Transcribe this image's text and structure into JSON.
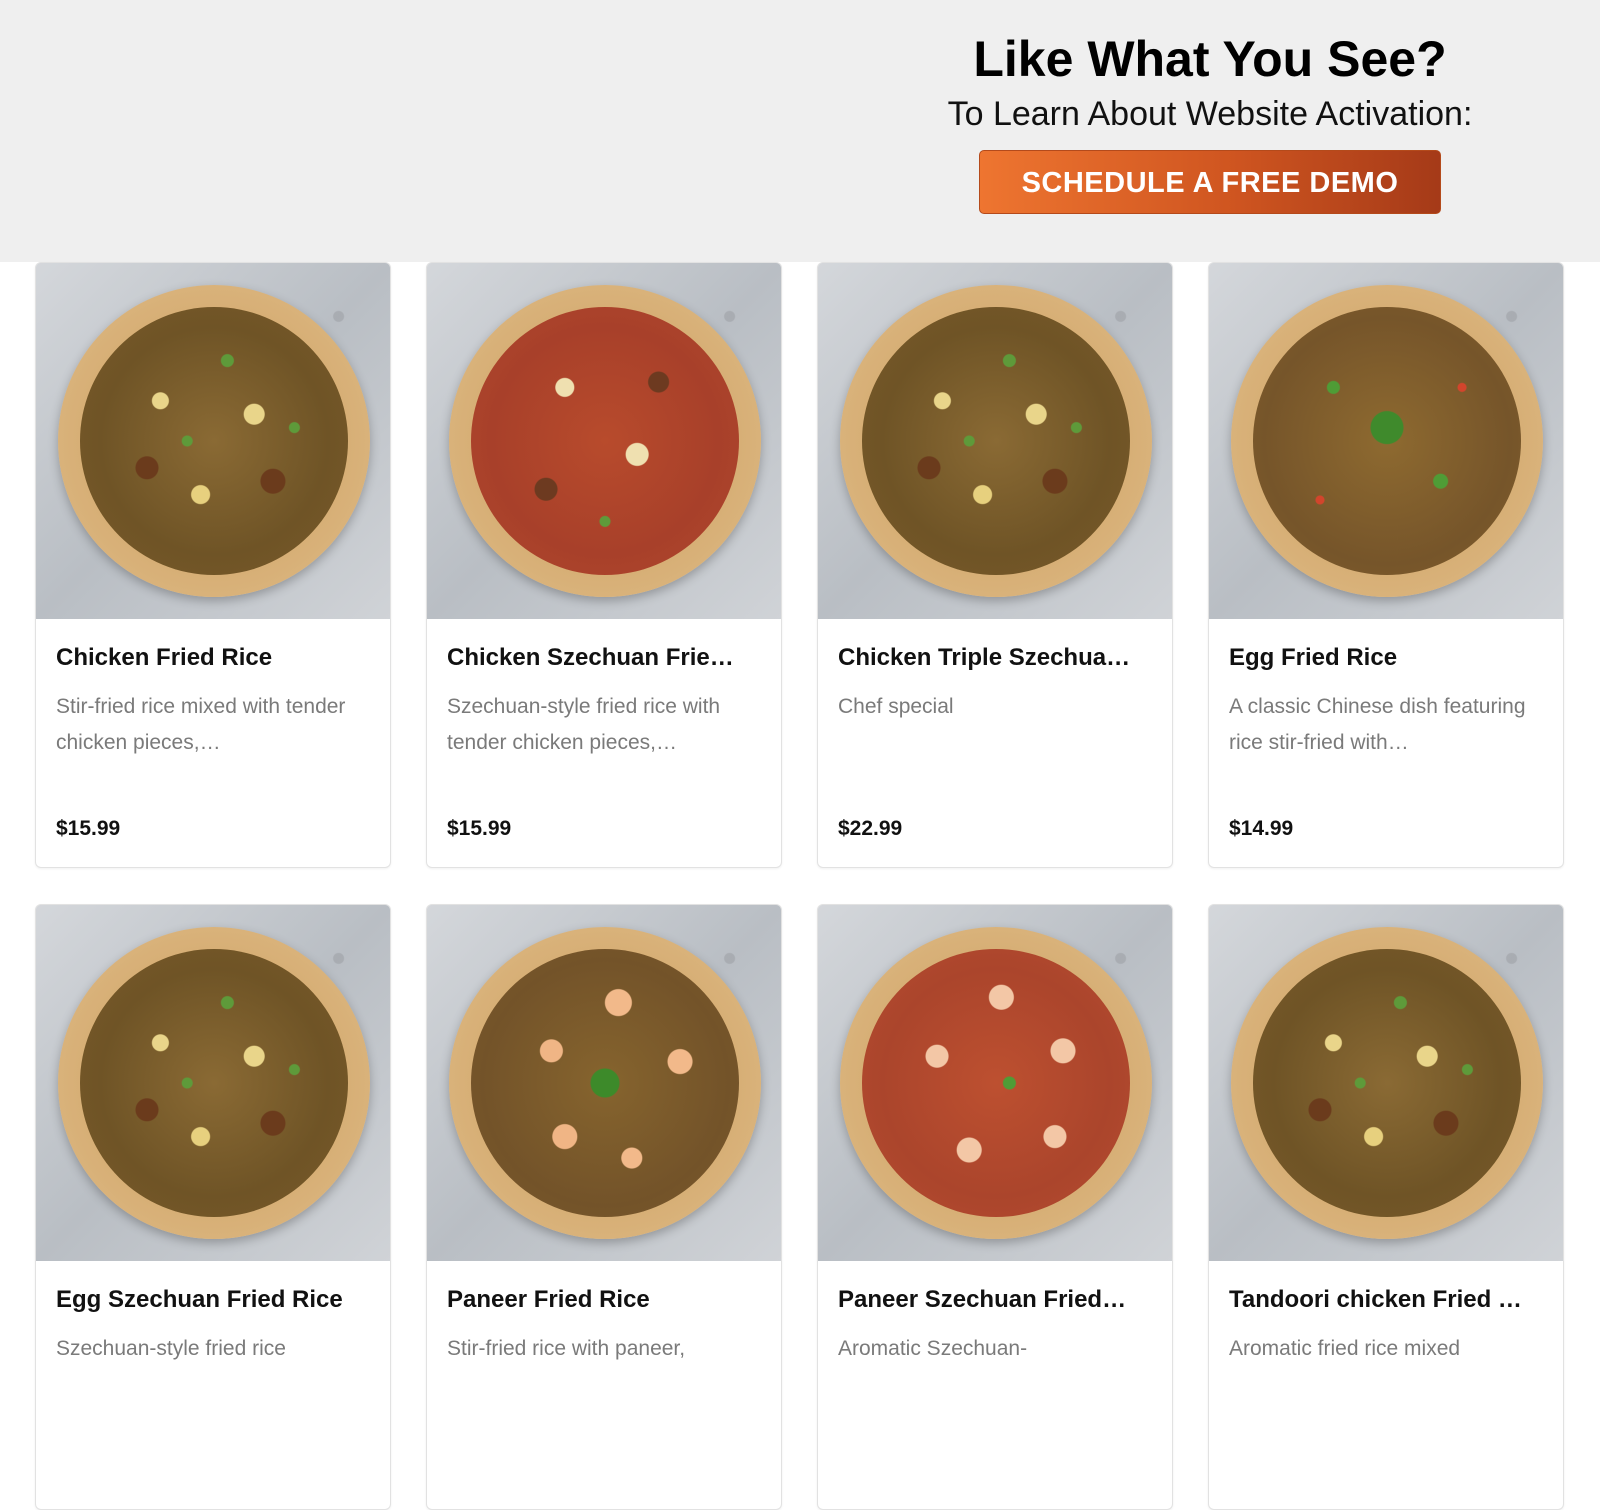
{
  "banner": {
    "title": "Like What You See?",
    "subtitle": "To Learn About Website Activation:",
    "cta_label": "SCHEDULE A FREE DEMO"
  },
  "menu": {
    "items": [
      {
        "name": "Chicken Fried Rice",
        "desc": "Stir-fried rice mixed with tender chicken pieces,…",
        "price": "$15.99",
        "photo": "mixed"
      },
      {
        "name": "Chicken Szechuan Frie…",
        "desc": "Szechuan-style fried rice with tender chicken pieces,…",
        "price": "$15.99",
        "photo": "red"
      },
      {
        "name": "Chicken Triple Szechua…",
        "desc": "Chef special",
        "price": "$22.99",
        "photo": "mixed"
      },
      {
        "name": "Egg Fried Rice",
        "desc": "A classic Chinese dish featuring rice stir-fried with…",
        "price": "$14.99",
        "photo": "green"
      },
      {
        "name": "Egg Szechuan Fried Rice",
        "desc": "Szechuan-style fried rice",
        "price": "",
        "photo": "mixed"
      },
      {
        "name": "Paneer Fried Rice",
        "desc": "Stir-fried rice with paneer,",
        "price": "",
        "photo": "paneer"
      },
      {
        "name": "Paneer Szechuan Fried…",
        "desc": "Aromatic Szechuan-",
        "price": "",
        "photo": "paneer-red"
      },
      {
        "name": "Tandoori chicken Fried …",
        "desc": "Aromatic fried rice mixed",
        "price": "",
        "photo": "mixed"
      }
    ]
  }
}
